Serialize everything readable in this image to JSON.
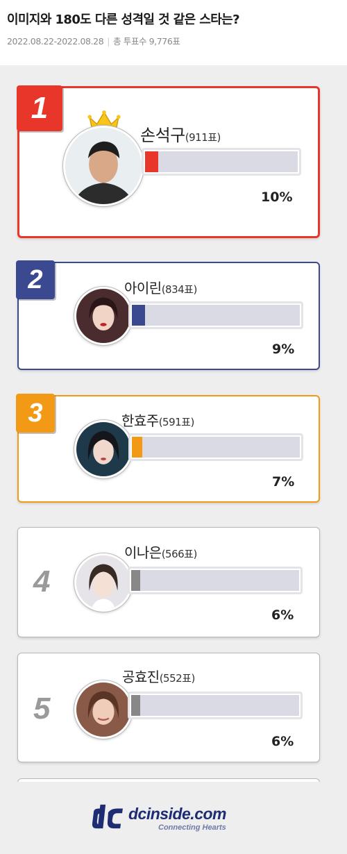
{
  "header": {
    "title": "이미지와 180도 다른 성격일 것 같은 스타는?",
    "date_range": "2022.08.22-2022.08.28",
    "total_label": "총 투표수 9,776표"
  },
  "colors": {
    "rank1": "#e8362a",
    "rank2": "#3b4a90",
    "rank3": "#f29a16",
    "neutral": "#888888",
    "bar_track": "#d9dae4"
  },
  "entries": [
    {
      "rank": "1",
      "name": "손석구",
      "votes": "(911표)",
      "percent_label": "10%",
      "percent": 10,
      "crown": true
    },
    {
      "rank": "2",
      "name": "아이린",
      "votes": "(834표)",
      "percent_label": "9%",
      "percent": 9
    },
    {
      "rank": "3",
      "name": "한효주",
      "votes": "(591표)",
      "percent_label": "7%",
      "percent": 7
    },
    {
      "rank": "4",
      "name": "이나은",
      "votes": "(566표)",
      "percent_label": "6%",
      "percent": 6
    },
    {
      "rank": "5",
      "name": "공효진",
      "votes": "(552표)",
      "percent_label": "6%",
      "percent": 6
    }
  ],
  "footer": {
    "logo_text": "dcinside.com",
    "tagline": "Connecting Hearts"
  }
}
